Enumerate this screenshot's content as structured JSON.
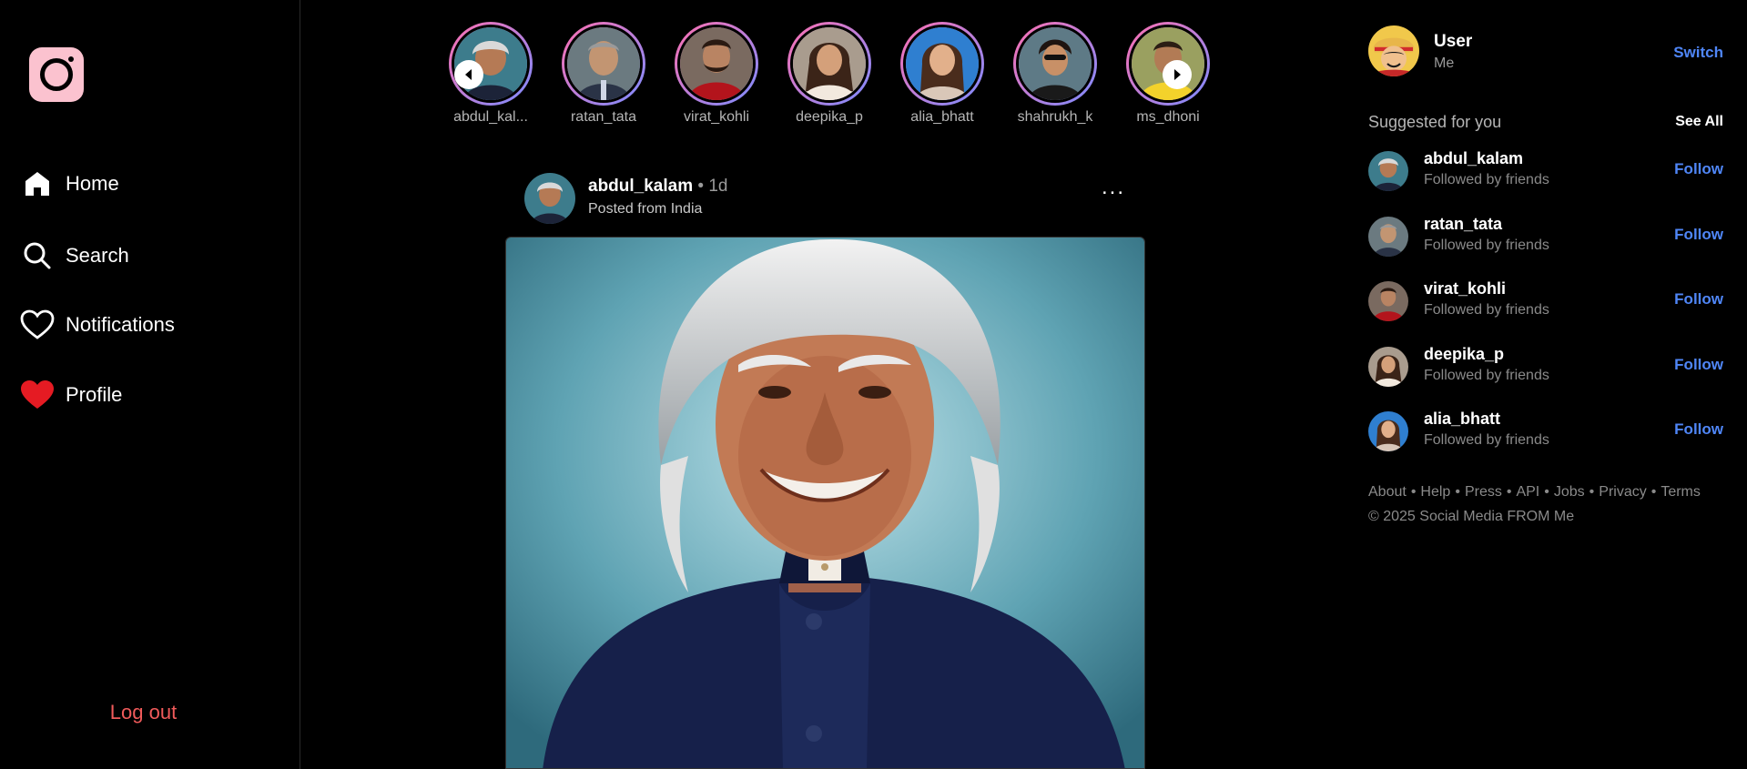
{
  "nav": {
    "items": [
      {
        "label": "Home",
        "icon": "home-icon"
      },
      {
        "label": "Search",
        "icon": "search-icon"
      },
      {
        "label": "Notifications",
        "icon": "heart-outline-icon"
      },
      {
        "label": "Profile",
        "icon": "heart-filled-icon"
      }
    ],
    "logout": "Log out"
  },
  "stories": [
    {
      "name": "abdul_kal..."
    },
    {
      "name": "ratan_tata"
    },
    {
      "name": "virat_kohli"
    },
    {
      "name": "deepika_p"
    },
    {
      "name": "alia_bhatt"
    },
    {
      "name": "shahrukh_k"
    },
    {
      "name": "ms_dhoni"
    }
  ],
  "post": {
    "username": "abdul_kalam",
    "time": " • 1d",
    "location": "Posted from India",
    "more": "..."
  },
  "me": {
    "name": "User",
    "sub": "Me",
    "switch": "Switch"
  },
  "suggestions": {
    "title": "Suggested for you",
    "see_all": "See All",
    "items": [
      {
        "username": "abdul_kalam",
        "sub": "Followed by friends",
        "action": "Follow"
      },
      {
        "username": "ratan_tata",
        "sub": "Followed by friends",
        "action": "Follow"
      },
      {
        "username": "virat_kohli",
        "sub": "Followed by friends",
        "action": "Follow"
      },
      {
        "username": "deepika_p",
        "sub": "Followed by friends",
        "action": "Follow"
      },
      {
        "username": "alia_bhatt",
        "sub": "Followed by friends",
        "action": "Follow"
      }
    ]
  },
  "footer": {
    "links": [
      "About",
      "Help",
      "Press",
      "API",
      "Jobs",
      "Privacy",
      "Terms"
    ],
    "copyright": "© 2025 Social Media FROM Me"
  },
  "colors": {
    "accent": "#4f86f7",
    "logout": "#f05a5a",
    "logo_bg": "#fbc2cf",
    "story_ring_start": "#ff6fb0",
    "story_ring_end": "#7b8cff"
  }
}
